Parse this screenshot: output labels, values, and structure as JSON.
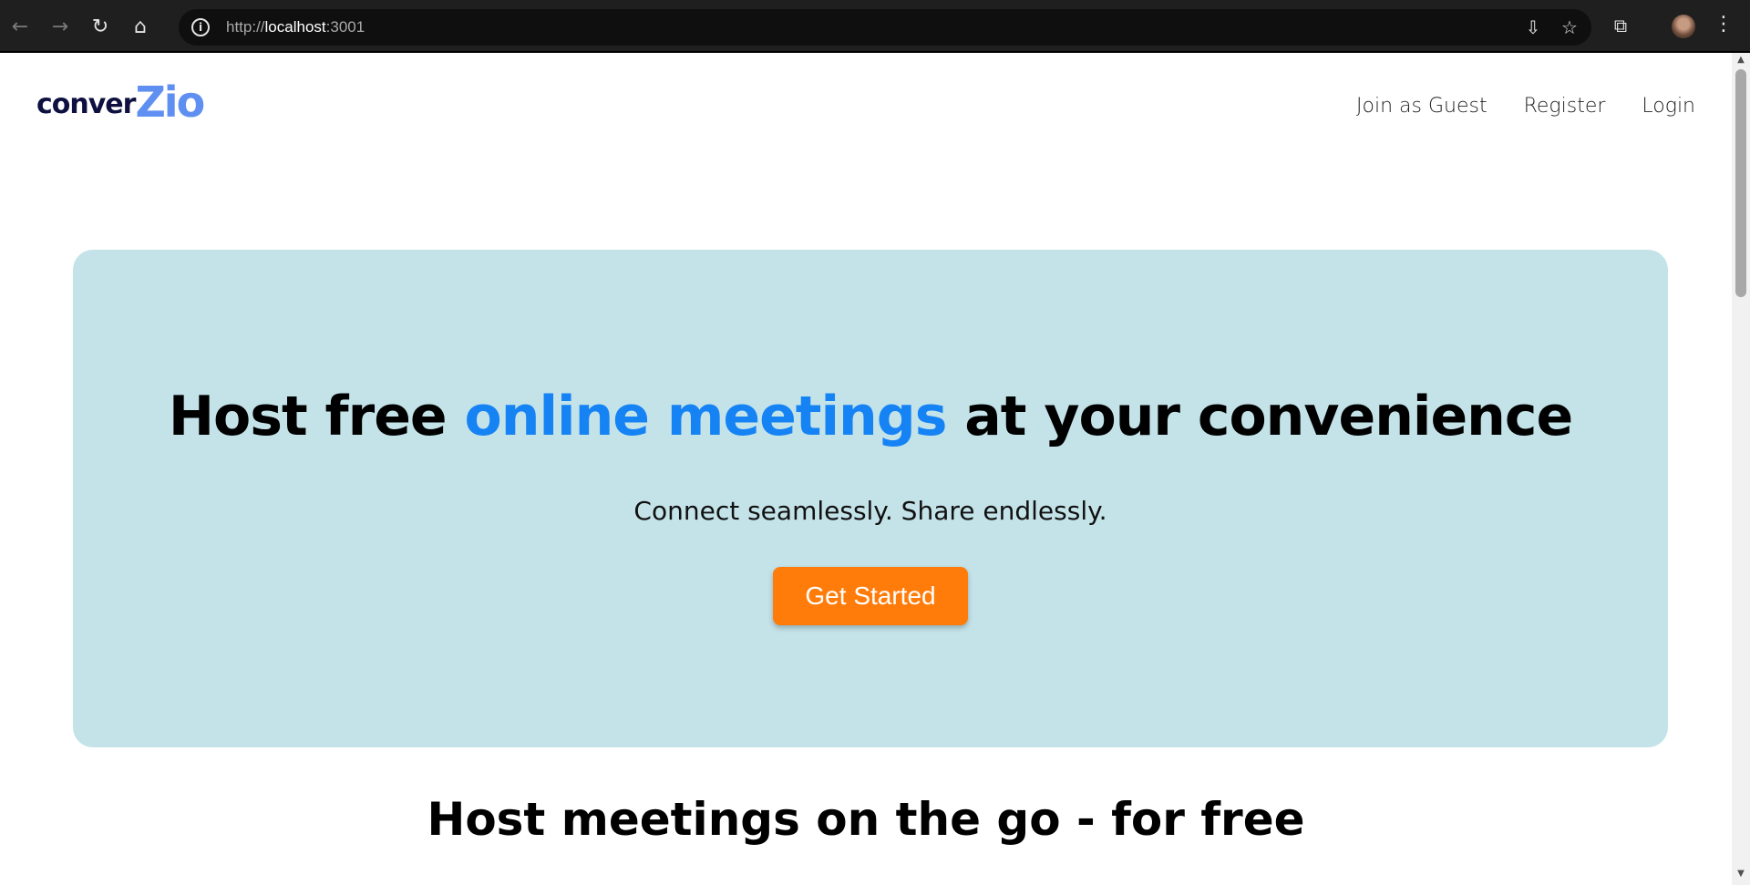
{
  "browser": {
    "back_glyph": "←",
    "forward_glyph": "→",
    "reload_glyph": "↻",
    "home_glyph": "⌂",
    "info_glyph": "i",
    "url_scheme": "http://",
    "url_host": "localhost",
    "url_port": ":3001",
    "install_glyph": "⇩",
    "star_glyph": "☆",
    "extensions_glyph": "⧉",
    "menu_glyph": "⋮"
  },
  "site": {
    "logo_part1": "conver",
    "logo_part2": "Zio",
    "nav": {
      "guest": "Join as Guest",
      "register": "Register",
      "login": "Login"
    }
  },
  "hero": {
    "headline_prefix": "Host free ",
    "headline_accent": "online meetings",
    "headline_suffix": " at your convenience",
    "tagline": "Connect seamlessly. Share endlessly.",
    "cta": "Get Started"
  },
  "section": {
    "title": "Host meetings on the go - for free"
  },
  "scrollbar": {
    "up_glyph": "▲",
    "down_glyph": "▼"
  },
  "colors": {
    "hero_bg": "#c4e3e9",
    "accent_blue": "#1683f4",
    "cta_orange": "#ff7c0a",
    "logo_dark": "#0e1140",
    "logo_light": "#5f8ff0"
  }
}
